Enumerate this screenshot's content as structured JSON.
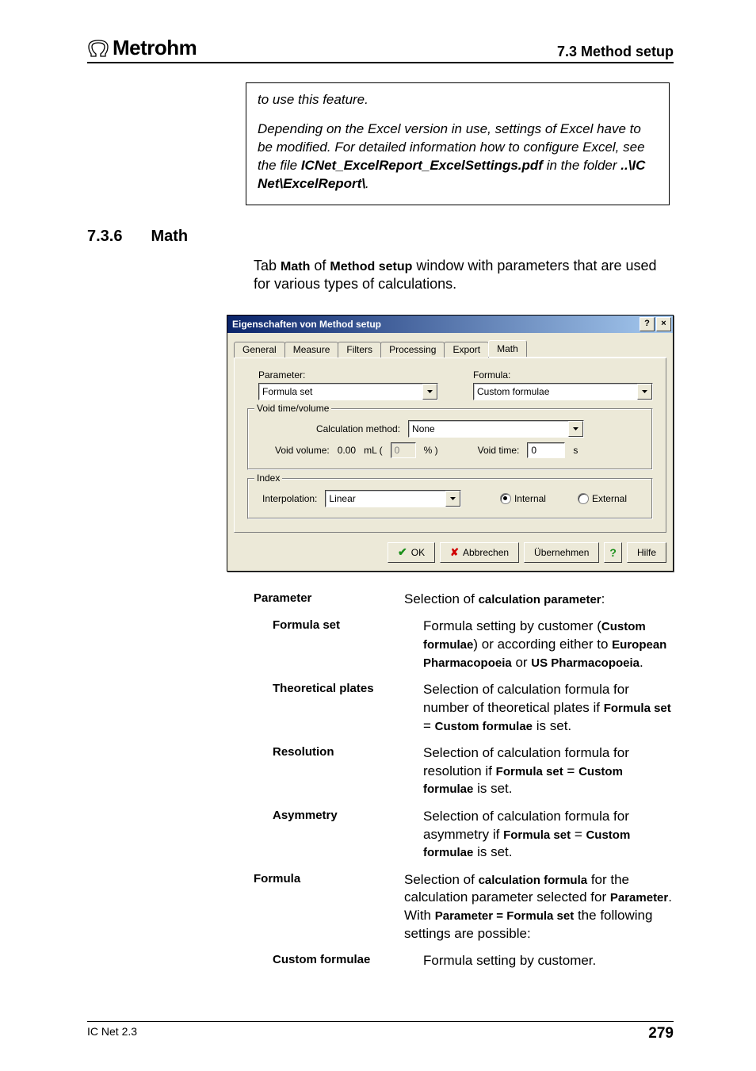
{
  "header": {
    "brand": "Metrohm",
    "section": "7.3  Method setup"
  },
  "note": {
    "p1": "to use this feature.",
    "p2a": "Depending on the Excel version in use, settings of Excel have to be modified. For detailed information how to configure Excel, see the file ",
    "p2b": "ICNet_ExcelReport_ExcelSettings.pdf",
    "p2c": " in the folder ",
    "p2d": "..\\IC Net\\ExcelReport\\",
    "p2e": "."
  },
  "heading": {
    "number": "7.3.6",
    "title": "Math"
  },
  "intro": {
    "pre": "Tab ",
    "b1": "Math",
    "mid": " of ",
    "b2": "Method setup",
    "post": " window with parameters that are used for various types of calculations."
  },
  "dialog": {
    "title": "Eigenschaften von Method setup",
    "help_btn": "?",
    "close_btn": "×",
    "tabs": [
      "General",
      "Measure",
      "Filters",
      "Processing",
      "Export",
      "Math"
    ],
    "active_tab": "Math",
    "parameter_label": "Parameter:",
    "parameter_value": "Formula set",
    "formula_label": "Formula:",
    "formula_value": "Custom formulae",
    "group_void": "Void time/volume",
    "calc_method_label": "Calculation method:",
    "calc_method_value": "None",
    "void_volume_label": "Void volume:",
    "void_volume_value": "0.00",
    "void_volume_unit_pre": "mL (",
    "void_volume_pct": "0",
    "void_volume_unit_post": "% )",
    "void_time_label": "Void time:",
    "void_time_value": "0",
    "void_time_unit": "s",
    "group_index": "Index",
    "interpolation_label": "Interpolation:",
    "interpolation_value": "Linear",
    "radio_internal": "Internal",
    "radio_external": "External",
    "btn_ok": "OK",
    "btn_cancel": "Abbrechen",
    "btn_apply": "Übernehmen",
    "btn_help": "Hilfe"
  },
  "defs": {
    "parameter": {
      "term": "Parameter",
      "d1": "Selection of ",
      "d2": "calculation parameter",
      "d3": ":"
    },
    "formula_set": {
      "term": "Formula set",
      "d1": "Formula setting by customer (",
      "d2": "Custom formulae",
      "d3": ") or according either to ",
      "d4": "European Pharmacopoeia",
      "d5": " or ",
      "d6": "US Pharmacopoeia",
      "d7": "."
    },
    "theoretical": {
      "term": "Theoretical plates",
      "d1": "Selection of calculation formula for number of theoretical plates if ",
      "d2": "Formula set",
      "eq": " = ",
      "d3": "Custom formulae",
      "d4": " is set."
    },
    "resolution": {
      "term": "Resolution",
      "d1": "Selection of calculation formula for resolution if ",
      "d2": "Formula set",
      "eq": " = ",
      "d3": "Custom formulae",
      "d4": " is set."
    },
    "asymmetry": {
      "term": "Asymmetry",
      "d1": "Selection of calculation formula for asymmetry if ",
      "d2": "Formula set",
      "eq": " = ",
      "d3": "Custom formulae",
      "d4": " is set."
    },
    "formula": {
      "term": "Formula",
      "d1": "Selection of ",
      "d2": "calculation formula",
      "d3": " for the calculation parameter selected for ",
      "d4": "Parameter",
      "d5": ". With ",
      "d6": "Parameter = Formula set",
      "d7": " the following settings are possible:"
    },
    "custom": {
      "term": "Custom formulae",
      "d1": "Formula setting by customer."
    }
  },
  "footer": {
    "left": "IC Net 2.3",
    "right": "279"
  }
}
